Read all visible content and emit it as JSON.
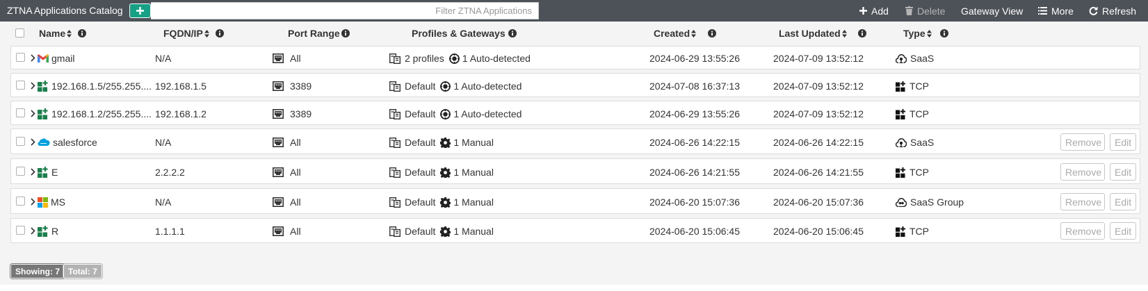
{
  "toolbar": {
    "title": "ZTNA Applications Catalog",
    "filter_placeholder": "Filter ZTNA Applications",
    "add_label": "Add",
    "delete_label": "Delete",
    "gateway_view_label": "Gateway View",
    "more_label": "More",
    "refresh_label": "Refresh"
  },
  "columns": {
    "name": "Name",
    "fqdn": "FQDN/IP",
    "port": "Port Range",
    "profiles": "Profiles & Gateways",
    "created": "Created",
    "updated": "Last Updated",
    "type": "Type"
  },
  "rows": [
    {
      "name": "gmail",
      "icon": "gmail-icon",
      "fqdn": "N/A",
      "port": "All",
      "profiles": "2 profiles",
      "gateway": "1 Auto-detected",
      "gateway_icon": "auto-detect-icon",
      "created": "2024-06-29 13:55:26",
      "updated": "2024-07-09 13:52:12",
      "type": "SaaS",
      "type_icon": "saas-icon",
      "actions": false
    },
    {
      "name": "192.168.1.5/255.255....",
      "icon": "tcp-app-icon",
      "fqdn": "192.168.1.5",
      "port": "3389",
      "profiles": "Default",
      "gateway": "1 Auto-detected",
      "gateway_icon": "auto-detect-icon",
      "created": "2024-07-08 16:37:13",
      "updated": "2024-07-09 13:52:12",
      "type": "TCP",
      "type_icon": "tcp-icon",
      "actions": false
    },
    {
      "name": "192.168.1.2/255.255....",
      "icon": "tcp-app-icon",
      "fqdn": "192.168.1.2",
      "port": "3389",
      "profiles": "Default",
      "gateway": "1 Auto-detected",
      "gateway_icon": "auto-detect-icon",
      "created": "2024-06-29 13:55:26",
      "updated": "2024-07-09 13:52:12",
      "type": "TCP",
      "type_icon": "tcp-icon",
      "actions": false
    },
    {
      "name": "salesforce",
      "icon": "salesforce-icon",
      "fqdn": "N/A",
      "port": "All",
      "profiles": "Default",
      "gateway": "1 Manual",
      "gateway_icon": "gear-icon",
      "created": "2024-06-26 14:22:15",
      "updated": "2024-06-26 14:22:15",
      "type": "SaaS",
      "type_icon": "saas-icon",
      "actions": true
    },
    {
      "name": "E",
      "icon": "tcp-app-icon",
      "fqdn": "2.2.2.2",
      "port": "All",
      "profiles": "Default",
      "gateway": "1 Manual",
      "gateway_icon": "gear-icon",
      "created": "2024-06-26 14:21:55",
      "updated": "2024-06-26 14:21:55",
      "type": "TCP",
      "type_icon": "tcp-icon",
      "actions": true
    },
    {
      "name": "MS",
      "icon": "microsoft-icon",
      "fqdn": "N/A",
      "port": "All",
      "profiles": "Default",
      "gateway": "1 Manual",
      "gateway_icon": "gear-icon",
      "created": "2024-06-20 15:07:36",
      "updated": "2024-06-20 15:07:36",
      "type": "SaaS Group",
      "type_icon": "saas-group-icon",
      "actions": true
    },
    {
      "name": "R",
      "icon": "tcp-app-icon",
      "fqdn": "1.1.1.1",
      "port": "All",
      "profiles": "Default",
      "gateway": "1 Manual",
      "gateway_icon": "gear-icon",
      "created": "2024-06-20 15:06:45",
      "updated": "2024-06-20 15:06:45",
      "type": "TCP",
      "type_icon": "tcp-icon",
      "actions": true
    }
  ],
  "row_actions": {
    "remove": "Remove",
    "edit": "Edit"
  },
  "footer": {
    "showing": "Showing: 7",
    "total": "Total: 7"
  },
  "colors": {
    "topbar": "#4c5257",
    "accent": "#16a085",
    "app_icon_green": "#1a7f4b"
  }
}
